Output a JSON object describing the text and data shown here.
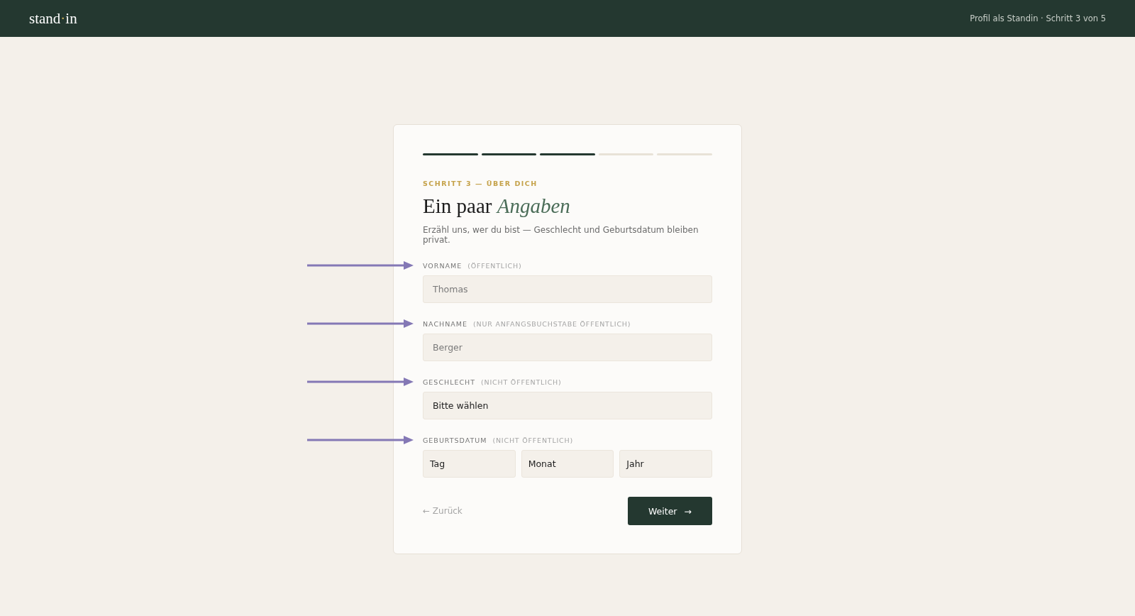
{
  "header": {
    "logo_left": "stand",
    "logo_dot": "·",
    "logo_right": "in",
    "step_info": "Profil als Standin · Schritt 3 von 5"
  },
  "progress": [
    {
      "done": true
    },
    {
      "done": true
    },
    {
      "done": true
    },
    {
      "done": false
    },
    {
      "done": false
    }
  ],
  "eyebrow": "SCHRITT 3 — ÜBER DICH",
  "title": {
    "plain": "Ein paar",
    "accent": "Angaben"
  },
  "subtitle": "Erzähl uns, wer du bist — Geschlecht und Geburtsdatum bleiben privat.",
  "fields": [
    {
      "kind": "text",
      "label": "VORNAME",
      "hint": "(ÖFFENTLICH)",
      "placeholder": "Thomas",
      "annotated": true
    },
    {
      "kind": "text",
      "label": "NACHNAME",
      "hint": "(NUR ANFANGSBUCHSTABE ÖFFENTLICH)",
      "placeholder": "Berger",
      "annotated": true
    },
    {
      "kind": "select",
      "label": "GESCHLECHT",
      "hint": "(NICHT ÖFFENTLICH)",
      "value": "Bitte wählen",
      "annotated": true
    },
    {
      "kind": "date",
      "label": "GEBURTSDATUM",
      "hint": "(NICHT ÖFFENTLICH)",
      "parts": [
        "Tag",
        "Monat",
        "Jahr"
      ],
      "annotated": true
    }
  ],
  "back_link": "← Zurück",
  "next_button": {
    "label": "Weiter",
    "arrow": "→"
  }
}
